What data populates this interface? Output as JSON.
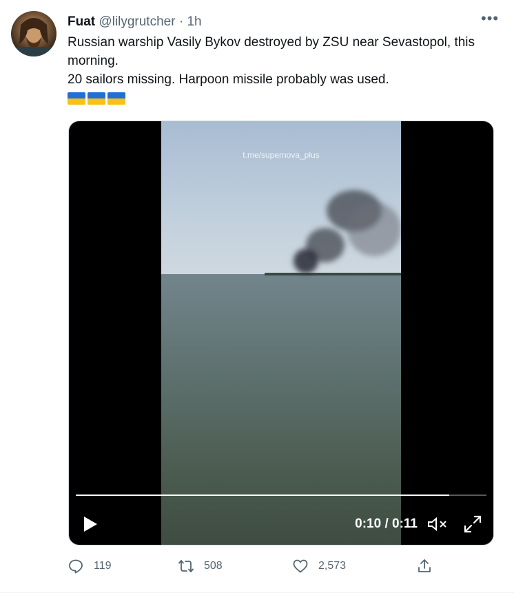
{
  "tweet": {
    "author_name": "Fuat",
    "author_handle": "@lilygrutcher",
    "separator": "·",
    "time": "1h",
    "more_label": "•••",
    "text_line1": "Russian warship Vasily Bykov destroyed by ZSU near Sevastopol, this morning.",
    "text_line2": "20 sailors missing. Harpoon missile probably was used.",
    "flags": [
      "ukraine-flag-icon",
      "ukraine-flag-icon",
      "ukraine-flag-icon"
    ]
  },
  "video": {
    "watermark": "t.me/supernova_plus",
    "timecode": "0:10 / 0:11",
    "progress": 0.91
  },
  "actions": {
    "replies": "119",
    "retweets": "508",
    "likes": "2,573"
  },
  "colors": {
    "text": "#0f1419",
    "secondary": "#536471",
    "flag_blue": "#1f6fd6",
    "flag_yellow": "#f6c21a"
  }
}
